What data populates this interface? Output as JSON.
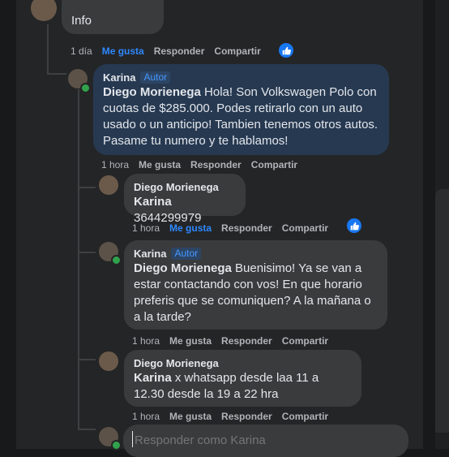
{
  "top_comment": {
    "text_partial": "Info",
    "time": "1 día",
    "like_label": "Me gusta",
    "reply_label": "Responder",
    "share_label": "Compartir"
  },
  "comments": [
    {
      "name": "Karina",
      "badge": "Autor",
      "mention": "Diego Morienega",
      "text": " Hola! Son Volkswagen Polo con cuotas de $285.000. Podes retirarlo con un auto usado o un anticipo! Tambien tenemos otros autos. Pasame tu numero y te hablamos!",
      "time": "1 hora",
      "like_label": "Me gusta",
      "reply_label": "Responder",
      "share_label": "Compartir"
    },
    {
      "name": "Diego Morienega",
      "mention": "Karina",
      "text": " 3644299979",
      "time": "1 hora",
      "like_label": "Me gusta",
      "reply_label": "Responder",
      "share_label": "Compartir"
    },
    {
      "name": "Karina",
      "badge": "Autor",
      "mention": "Diego Morienega",
      "text": " Buenisimo! Ya se van a estar contactando con vos! En que horario preferis que se comuniquen? A la mañana o a la tarde?",
      "time": "1 hora",
      "like_label": "Me gusta",
      "reply_label": "Responder",
      "share_label": "Compartir"
    },
    {
      "name": "Diego Morienega",
      "mention": "Karina",
      "text": " x whatsapp desde laa 11 a 12.30 desde la 19 a 22 hra",
      "time": "1 hora",
      "like_label": "Me gusta",
      "reply_label": "Responder",
      "share_label": "Compartir"
    }
  ],
  "reply_box": {
    "placeholder": "Responder como Karina"
  },
  "colors": {
    "author_bubble": "#263951",
    "bubble": "#3a3b3c",
    "liked": "#2d88ff",
    "online": "#31a24c"
  }
}
